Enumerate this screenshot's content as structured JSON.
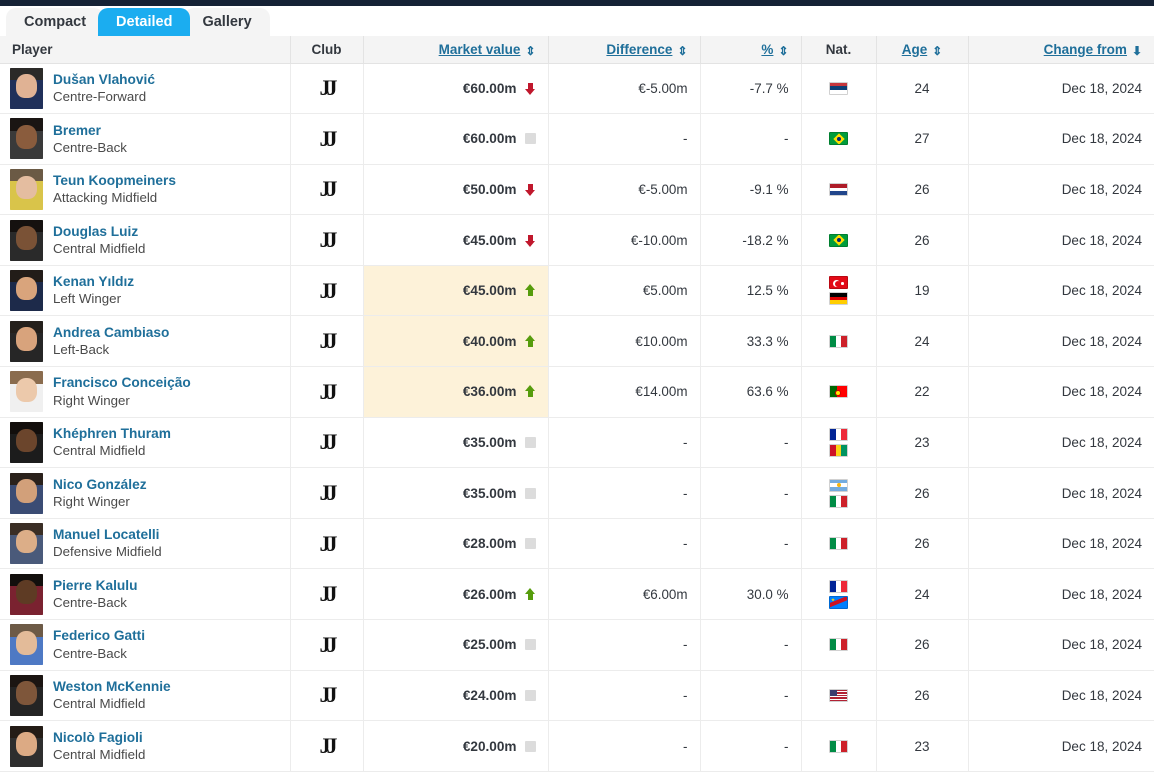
{
  "topbar": {
    "accent_color": "#152235"
  },
  "tabs": [
    {
      "label": "Compact",
      "active": false
    },
    {
      "label": "Detailed",
      "active": true
    },
    {
      "label": "Gallery",
      "active": false
    }
  ],
  "table": {
    "columns": [
      {
        "key": "player",
        "label": "Player",
        "sortable": false,
        "sort": "none",
        "align": "left"
      },
      {
        "key": "club",
        "label": "Club",
        "sortable": false,
        "sort": "none",
        "align": "center"
      },
      {
        "key": "market_value",
        "label": "Market value",
        "sortable": true,
        "sort": "both",
        "align": "right"
      },
      {
        "key": "difference",
        "label": "Difference",
        "sortable": true,
        "sort": "both",
        "align": "right"
      },
      {
        "key": "percent",
        "label": "%",
        "sortable": true,
        "sort": "both",
        "align": "right"
      },
      {
        "key": "nationality",
        "label": "Nat.",
        "sortable": false,
        "sort": "none",
        "align": "center"
      },
      {
        "key": "age",
        "label": "Age",
        "sortable": true,
        "sort": "both",
        "align": "center"
      },
      {
        "key": "change_from",
        "label": "Change from",
        "sortable": true,
        "sort": "desc",
        "align": "right"
      }
    ],
    "club_logo": "JJ",
    "rows": [
      {
        "name": "Dušan Vlahović",
        "position": "Centre-Forward",
        "club": "Juventus FC",
        "market_value": "€60.00m",
        "trend": "down",
        "highlight": false,
        "difference": "€-5.00m",
        "percent": "-7.7 %",
        "nationalities": [
          "Serbia"
        ],
        "age": "24",
        "change_from": "Dec 18, 2024",
        "photo": {
          "hair": "#2b2a28",
          "skin": "#e0b294",
          "shirt": "#20305a"
        }
      },
      {
        "name": "Bremer",
        "position": "Centre-Back",
        "club": "Juventus FC",
        "market_value": "€60.00m",
        "trend": "flat",
        "highlight": false,
        "difference": "-",
        "percent": "-",
        "nationalities": [
          "Brazil"
        ],
        "age": "27",
        "change_from": "Dec 18, 2024",
        "photo": {
          "hair": "#1a1513",
          "skin": "#8a5c3d",
          "shirt": "#3a3a3a"
        }
      },
      {
        "name": "Teun Koopmeiners",
        "position": "Attacking Midfield",
        "club": "Juventus FC",
        "market_value": "€50.00m",
        "trend": "down",
        "highlight": false,
        "difference": "€-5.00m",
        "percent": "-9.1 %",
        "nationalities": [
          "Netherlands"
        ],
        "age": "26",
        "change_from": "Dec 18, 2024",
        "photo": {
          "hair": "#6b5a45",
          "skin": "#e4bda0",
          "shirt": "#d9c44a"
        }
      },
      {
        "name": "Douglas Luiz",
        "position": "Central Midfield",
        "club": "Juventus FC",
        "market_value": "€45.00m",
        "trend": "down",
        "highlight": false,
        "difference": "€-10.00m",
        "percent": "-18.2 %",
        "nationalities": [
          "Brazil"
        ],
        "age": "26",
        "change_from": "Dec 18, 2024",
        "photo": {
          "hair": "#15110f",
          "skin": "#7a5236",
          "shirt": "#2a2a2a"
        }
      },
      {
        "name": "Kenan Yıldız",
        "position": "Left Winger",
        "club": "Juventus FC",
        "market_value": "€45.00m",
        "trend": "up",
        "highlight": true,
        "difference": "€5.00m",
        "percent": "12.5 %",
        "nationalities": [
          "Turkey",
          "Germany"
        ],
        "age": "19",
        "change_from": "Dec 18, 2024",
        "photo": {
          "hair": "#221c18",
          "skin": "#d9a47c",
          "shirt": "#1d2a4a"
        }
      },
      {
        "name": "Andrea Cambiaso",
        "position": "Left-Back",
        "club": "Juventus FC",
        "market_value": "€40.00m",
        "trend": "up",
        "highlight": true,
        "difference": "€10.00m",
        "percent": "33.3 %",
        "nationalities": [
          "Italy"
        ],
        "age": "24",
        "change_from": "Dec 18, 2024",
        "photo": {
          "hair": "#24201c",
          "skin": "#d8a37c",
          "shirt": "#262626"
        }
      },
      {
        "name": "Francisco Conceição",
        "position": "Right Winger",
        "club": "Juventus FC",
        "market_value": "€36.00m",
        "trend": "up",
        "highlight": true,
        "difference": "€14.00m",
        "percent": "63.6 %",
        "nationalities": [
          "Portugal"
        ],
        "age": "22",
        "change_from": "Dec 18, 2024",
        "photo": {
          "hair": "#8a6c4e",
          "skin": "#ecc9ab",
          "shirt": "#f0f0f0"
        }
      },
      {
        "name": "Khéphren Thuram",
        "position": "Central Midfield",
        "club": "Juventus FC",
        "market_value": "€35.00m",
        "trend": "flat",
        "highlight": false,
        "difference": "-",
        "percent": "-",
        "nationalities": [
          "France",
          "Guinea"
        ],
        "age": "23",
        "change_from": "Dec 18, 2024",
        "photo": {
          "hair": "#120e0c",
          "skin": "#6b452c",
          "shirt": "#1c1c1c"
        }
      },
      {
        "name": "Nico González",
        "position": "Right Winger",
        "club": "Juventus FC",
        "market_value": "€35.00m",
        "trend": "flat",
        "highlight": false,
        "difference": "-",
        "percent": "-",
        "nationalities": [
          "Argentina",
          "Italy"
        ],
        "age": "26",
        "change_from": "Dec 18, 2024",
        "photo": {
          "hair": "#2a211b",
          "skin": "#d2a07a",
          "shirt": "#3b4c74"
        }
      },
      {
        "name": "Manuel Locatelli",
        "position": "Defensive Midfield",
        "club": "Juventus FC",
        "market_value": "€28.00m",
        "trend": "flat",
        "highlight": false,
        "difference": "-",
        "percent": "-",
        "nationalities": [
          "Italy"
        ],
        "age": "26",
        "change_from": "Dec 18, 2024",
        "photo": {
          "hair": "#3a2e25",
          "skin": "#dcae88",
          "shirt": "#4a5a7a"
        }
      },
      {
        "name": "Pierre Kalulu",
        "position": "Centre-Back",
        "club": "Juventus FC",
        "market_value": "€26.00m",
        "trend": "up",
        "highlight": false,
        "difference": "€6.00m",
        "percent": "30.0 %",
        "nationalities": [
          "France",
          "DR Congo"
        ],
        "age": "24",
        "change_from": "Dec 18, 2024",
        "photo": {
          "hair": "#120f0d",
          "skin": "#5e3b24",
          "shirt": "#7a2230"
        }
      },
      {
        "name": "Federico Gatti",
        "position": "Centre-Back",
        "club": "Juventus FC",
        "market_value": "€25.00m",
        "trend": "flat",
        "highlight": false,
        "difference": "-",
        "percent": "-",
        "nationalities": [
          "Italy"
        ],
        "age": "26",
        "change_from": "Dec 18, 2024",
        "photo": {
          "hair": "#6d5a46",
          "skin": "#e3bb99",
          "shirt": "#4e79c4"
        }
      },
      {
        "name": "Weston McKennie",
        "position": "Central Midfield",
        "club": "Juventus FC",
        "market_value": "€24.00m",
        "trend": "flat",
        "highlight": false,
        "difference": "-",
        "percent": "-",
        "nationalities": [
          "United States"
        ],
        "age": "26",
        "change_from": "Dec 18, 2024",
        "photo": {
          "hair": "#1b1512",
          "skin": "#7e563a",
          "shirt": "#242424"
        }
      },
      {
        "name": "Nicolò Fagioli",
        "position": "Central Midfield",
        "club": "Juventus FC",
        "market_value": "€20.00m",
        "trend": "flat",
        "highlight": false,
        "difference": "-",
        "percent": "-",
        "nationalities": [
          "Italy"
        ],
        "age": "23",
        "change_from": "Dec 18, 2024",
        "photo": {
          "hair": "#241c16",
          "skin": "#dcaa84",
          "shirt": "#2e2e2e"
        }
      }
    ]
  },
  "colors": {
    "accent_tab": "#1badf0",
    "link": "#1f6f9a",
    "up": "#7cb518",
    "down": "#c0172c",
    "highlight_row": "#fdf2d9",
    "header_bg": "#f4f4f4"
  }
}
